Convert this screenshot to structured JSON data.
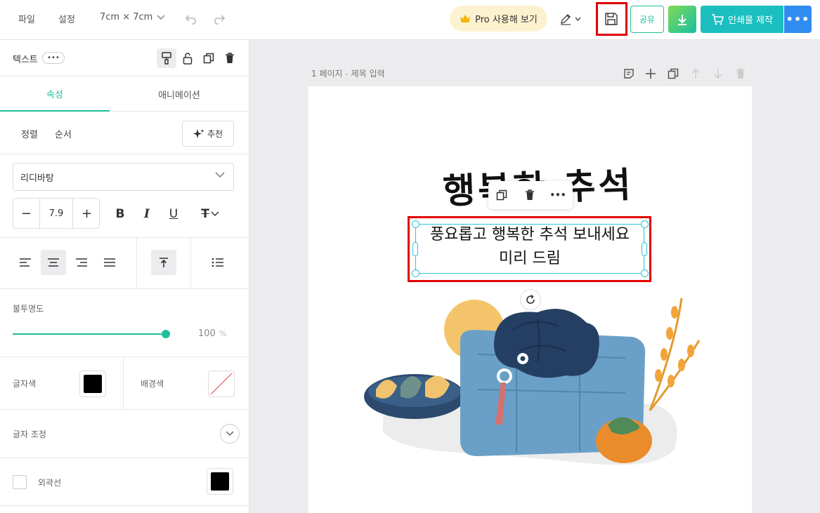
{
  "menu": {
    "file": "파일",
    "settings": "설정",
    "size": "7cm × 7cm"
  },
  "toolbar": {
    "pro_label": "Pro 사용해 보기",
    "share_label": "공유",
    "print_label": "인쇄물 제작"
  },
  "panel": {
    "title": "텍스트",
    "dots": "•••",
    "tabs": {
      "properties": "속성",
      "animation": "애니메이션"
    },
    "sub": {
      "align": "정렬",
      "order": "순서",
      "recommend": "추천"
    },
    "font_name": "리디바탕",
    "font_size": "7.9",
    "format": {
      "bold": "B",
      "italic": "I",
      "underline": "U",
      "strike": "T"
    },
    "opacity_label": "불투명도",
    "opacity_value": "100",
    "opacity_unit": "%",
    "opacity_level": 1.0,
    "text_color_label": "글자색",
    "text_color": "#000000",
    "bg_color_label": "배경색",
    "adjust_label": "글자 조정",
    "stroke_label": "외곽선",
    "stroke_color": "#000000"
  },
  "canvas": {
    "page_label": "1 페이지",
    "page_sep": " - ",
    "page_title_placeholder": "제목 입력",
    "title_art": "행복한 추석",
    "selected_text_line1": "풍요롭고 행복한 추석 보내세요",
    "selected_text_line2": "미리 드림"
  },
  "colors": {
    "accent": "#1ebf9a",
    "highlight": "#e00000",
    "selection": "#2ec4d6",
    "print_button": "#1bbfbf",
    "more_button": "#2f8cf0"
  }
}
